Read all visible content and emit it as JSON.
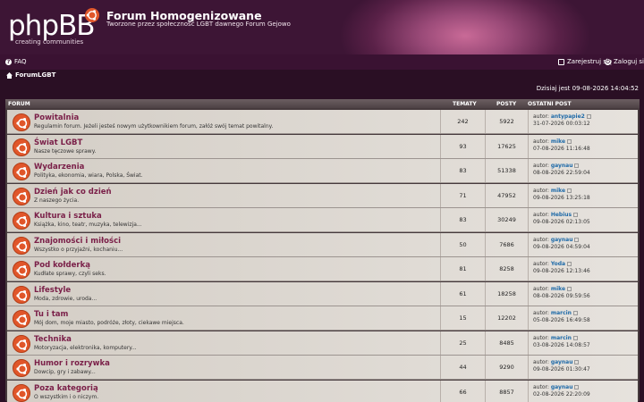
{
  "header": {
    "logo_text": "phpBB",
    "logo_tagline": "creating  communities",
    "site_title": "Forum Homogenizowane",
    "site_description": "Tworzone przez społeczność LGBT dawnego Forum Gejowo"
  },
  "navbar": {
    "faq": "FAQ",
    "register": "Zarejestruj się",
    "login": "Zaloguj się"
  },
  "breadcrumb": {
    "home": "ForumLGBT"
  },
  "datetime": "Dzisiaj jest 09-08-2026 14:04:52",
  "table": {
    "col_forum": "FORUM",
    "col_topics": "TEMATY",
    "col_posts": "POSTY",
    "col_last_post": "OSTATNI POST",
    "author_prefix": "autor:",
    "rows": [
      {
        "title": "Powitalnia",
        "desc": "Regulamin forum. Jeżeli jesteś nowym użytkownikiem forum, załóż swój temat powitalny.",
        "topics": "242",
        "posts": "5922",
        "author": "antypapie2",
        "date": "31-07-2026 00:03:12"
      },
      {
        "title": "Świat LGBT",
        "desc": "Nasze tęczowe sprawy.",
        "topics": "93",
        "posts": "17625",
        "author": "mike",
        "date": "07-08-2026 11:16:48"
      },
      {
        "title": "Wydarzenia",
        "desc": "Polityka, ekonomia, wiara, Polska, Świat.",
        "topics": "83",
        "posts": "51338",
        "author": "gaynau",
        "date": "08-08-2026 22:59:04"
      },
      {
        "title": "Dzień jak co dzień",
        "desc": "Z naszego życia.",
        "topics": "71",
        "posts": "47952",
        "author": "mike",
        "date": "09-08-2026 13:25:18"
      },
      {
        "title": "Kultura i sztuka",
        "desc": "Książka, kino, teatr, muzyka, telewizja...",
        "topics": "83",
        "posts": "30249",
        "author": "Hebius",
        "date": "09-08-2026 02:13:05"
      },
      {
        "title": "Znajomości i miłości",
        "desc": "Wszystko o przyjaźni, kochaniu...",
        "topics": "50",
        "posts": "7686",
        "author": "gaynau",
        "date": "09-08-2026 04:59:04"
      },
      {
        "title": "Pod kołderką",
        "desc": "Kudłate sprawy, czyli seks.",
        "topics": "81",
        "posts": "8258",
        "author": "Yoda",
        "date": "09-08-2026 12:13:46"
      },
      {
        "title": "Lifestyle",
        "desc": "Moda, zdrowie, uroda...",
        "topics": "61",
        "posts": "18258",
        "author": "mike",
        "date": "08-08-2026 09:59:56"
      },
      {
        "title": "Tu i tam",
        "desc": "Mój dom, moje miasto, podróże, złoty, ciekawe miejsca.",
        "topics": "15",
        "posts": "12202",
        "author": "marcin",
        "date": "05-08-2026 16:49:58"
      },
      {
        "title": "Technika",
        "desc": "Motoryzacja, elektronika, komputery...",
        "topics": "25",
        "posts": "8485",
        "author": "marcin",
        "date": "03-08-2026 14:08:57"
      },
      {
        "title": "Humor i rozrywka",
        "desc": "Dowcip, gry i zabawy...",
        "topics": "44",
        "posts": "9290",
        "author": "gaynau",
        "date": "09-08-2026 01:30:47"
      },
      {
        "title": "Poza kategorią",
        "desc": "O wszystkim i o niczym.",
        "topics": "66",
        "posts": "8857",
        "author": "gaynau",
        "date": "02-08-2026 22:20:09"
      }
    ]
  }
}
